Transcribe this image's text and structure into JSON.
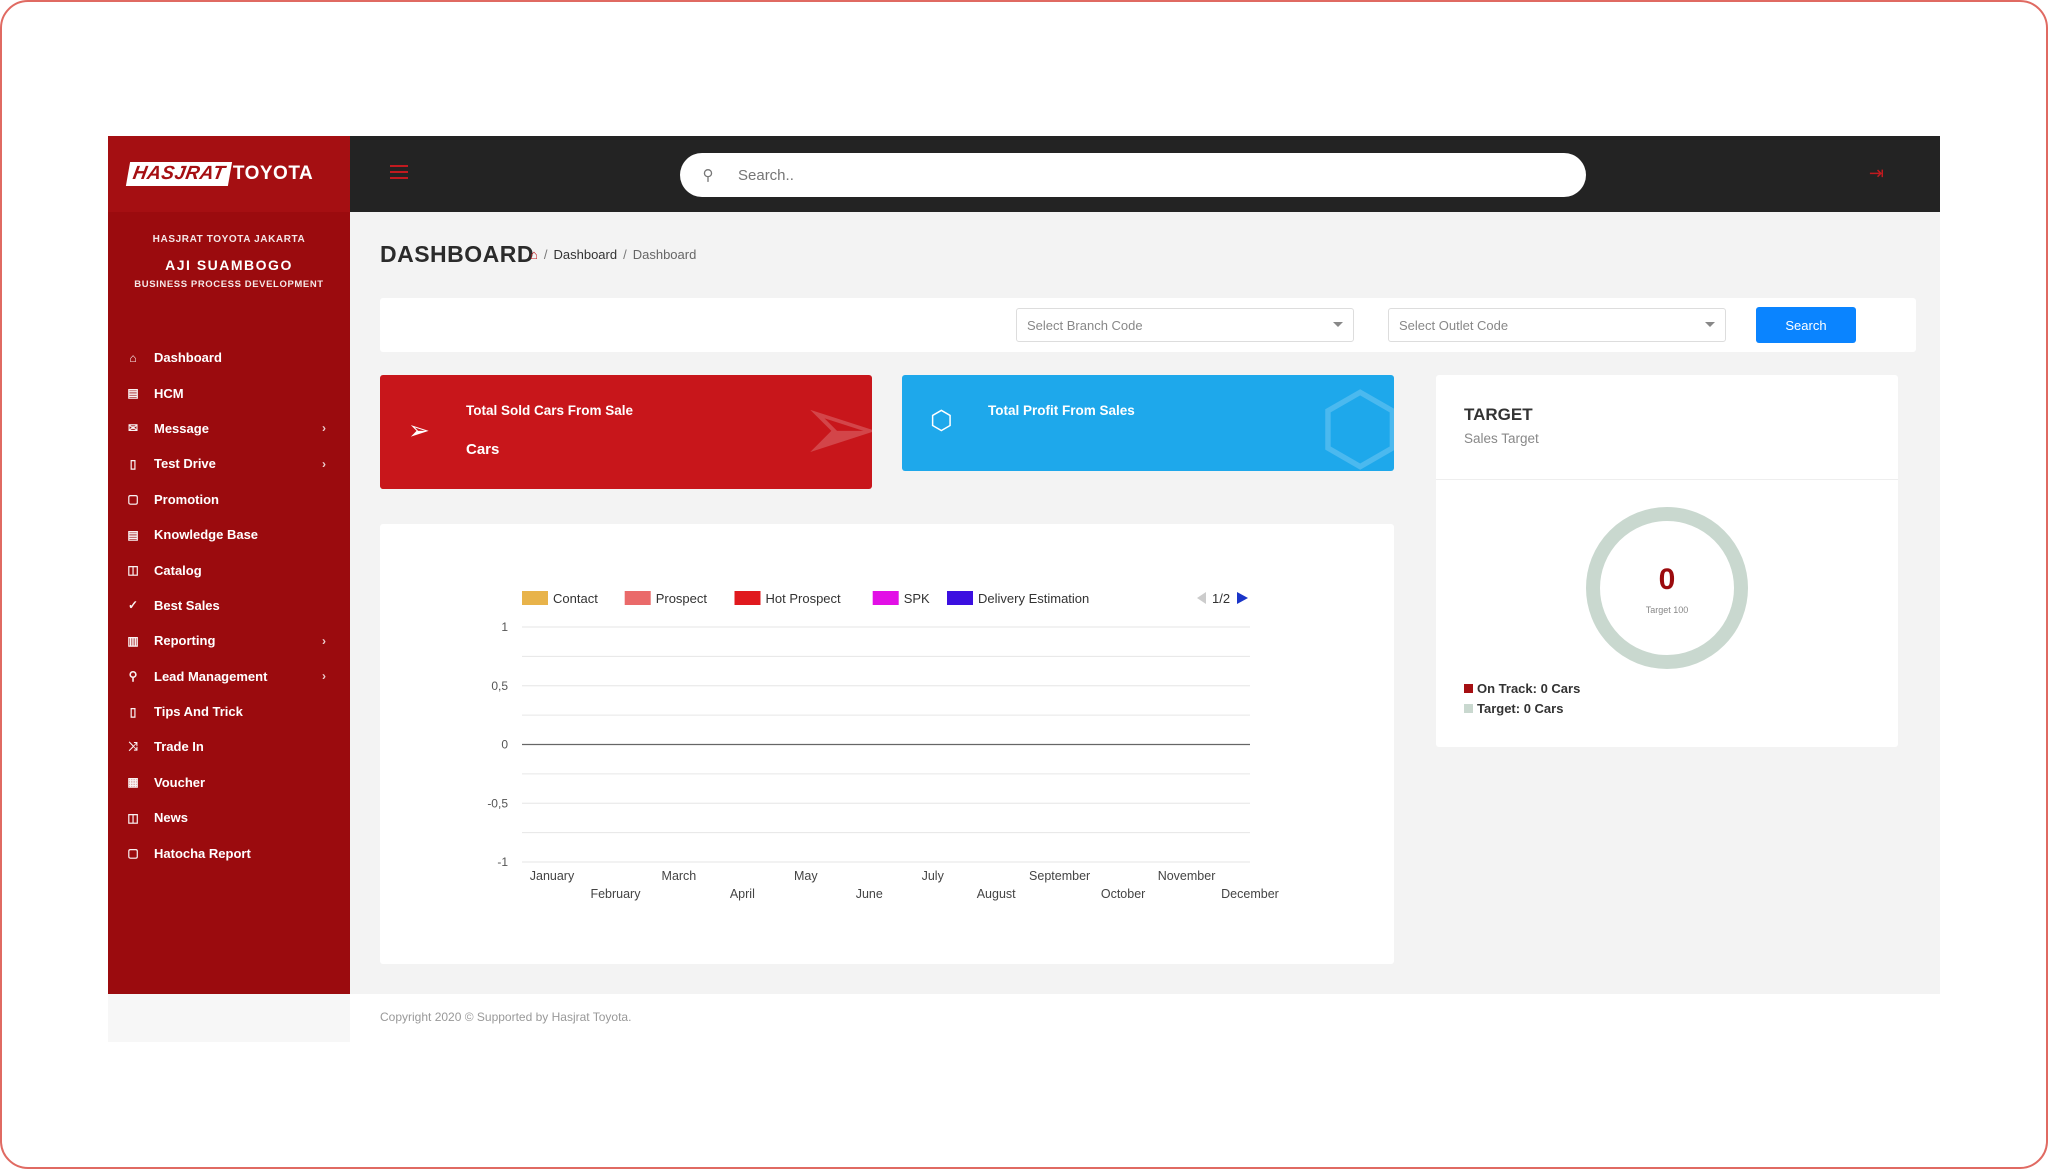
{
  "brand": {
    "logo_left": "HASJRAT",
    "logo_right": "TOYOTA"
  },
  "profile": {
    "company": "HASJRAT TOYOTA JAKARTA",
    "name": "AJI SUAMBOGO",
    "role": "BUSINESS PROCESS DEVELOPMENT"
  },
  "sidebar": {
    "items": [
      {
        "label": "Dashboard",
        "icon": "home-icon",
        "glyph": "⌂",
        "chevron": false
      },
      {
        "label": "HCM",
        "icon": "database-icon",
        "glyph": "▤",
        "chevron": false
      },
      {
        "label": "Message",
        "icon": "envelope-icon",
        "glyph": "✉",
        "chevron": true
      },
      {
        "label": "Test Drive",
        "icon": "tablet-icon",
        "glyph": "▯",
        "chevron": true
      },
      {
        "label": "Promotion",
        "icon": "clipboard-icon",
        "glyph": "▢",
        "chevron": false
      },
      {
        "label": "Knowledge Base",
        "icon": "database-icon",
        "glyph": "▤",
        "chevron": false
      },
      {
        "label": "Catalog",
        "icon": "book-icon",
        "glyph": "◫",
        "chevron": false
      },
      {
        "label": "Best Sales",
        "icon": "thumbs-up-icon",
        "glyph": "✓",
        "chevron": false
      },
      {
        "label": "Reporting",
        "icon": "file-icon",
        "glyph": "▥",
        "chevron": true
      },
      {
        "label": "Lead Management",
        "icon": "user-icon",
        "glyph": "⚲",
        "chevron": true
      },
      {
        "label": "Tips And Trick",
        "icon": "tablet-icon",
        "glyph": "▯",
        "chevron": false
      },
      {
        "label": "Trade In",
        "icon": "shuffle-icon",
        "glyph": "⤨",
        "chevron": false
      },
      {
        "label": "Voucher",
        "icon": "ticket-icon",
        "glyph": "▦",
        "chevron": false
      },
      {
        "label": "News",
        "icon": "book-icon",
        "glyph": "◫",
        "chevron": false
      },
      {
        "label": "Hatocha Report",
        "icon": "clipboard-icon",
        "glyph": "▢",
        "chevron": false
      }
    ],
    "chevron_glyph": "›"
  },
  "topbar": {
    "search_placeholder": "Search..",
    "search_glyph": "⚲",
    "logout_glyph": "⇥"
  },
  "page": {
    "title": "DASHBOARD",
    "breadcrumb": {
      "sep": "/",
      "item1": "Dashboard",
      "item2": "Dashboard",
      "home_glyph": "⌂"
    }
  },
  "filters": {
    "branch_placeholder": "Select Branch Code",
    "outlet_placeholder": "Select Outlet Code",
    "search_button": "Search"
  },
  "stats": {
    "sold": {
      "label": "Total Sold Cars From Sale",
      "unit": "Cars",
      "glyph": "➢"
    },
    "profit": {
      "label": "Total Profit From Sales",
      "glyph": "⬡"
    }
  },
  "target": {
    "title": "TARGET",
    "subtitle": "Sales Target",
    "value": "0",
    "sub": "Target 100",
    "progress": 0,
    "on_track": "On Track: 0 Cars",
    "target_cars": "Target: 0 Cars",
    "colors": {
      "on_track": "#a50f12",
      "target": "#c9d8cf"
    }
  },
  "footer": {
    "text": "Copyright 2020 © Supported by Hasjrat Toyota."
  },
  "chart_data": {
    "type": "line",
    "x": [
      "January",
      "February",
      "March",
      "April",
      "May",
      "June",
      "July",
      "August",
      "September",
      "October",
      "November",
      "December"
    ],
    "series": [
      {
        "name": "Contact",
        "color": "#e8b34a",
        "values": []
      },
      {
        "name": "Prospect",
        "color": "#ea6a6a",
        "values": []
      },
      {
        "name": "Hot Prospect",
        "color": "#e0191e",
        "values": []
      },
      {
        "name": "SPK",
        "color": "#e20fe6",
        "values": []
      },
      {
        "name": "Delivery Estimation",
        "color": "#3b0fe0",
        "values": []
      }
    ],
    "ylim": [
      -1,
      1
    ],
    "yticks": [
      "1",
      "0,5",
      "0",
      "-0,5",
      "-1"
    ],
    "legend_position": "top",
    "legend_page": "1/2",
    "grid": true
  }
}
